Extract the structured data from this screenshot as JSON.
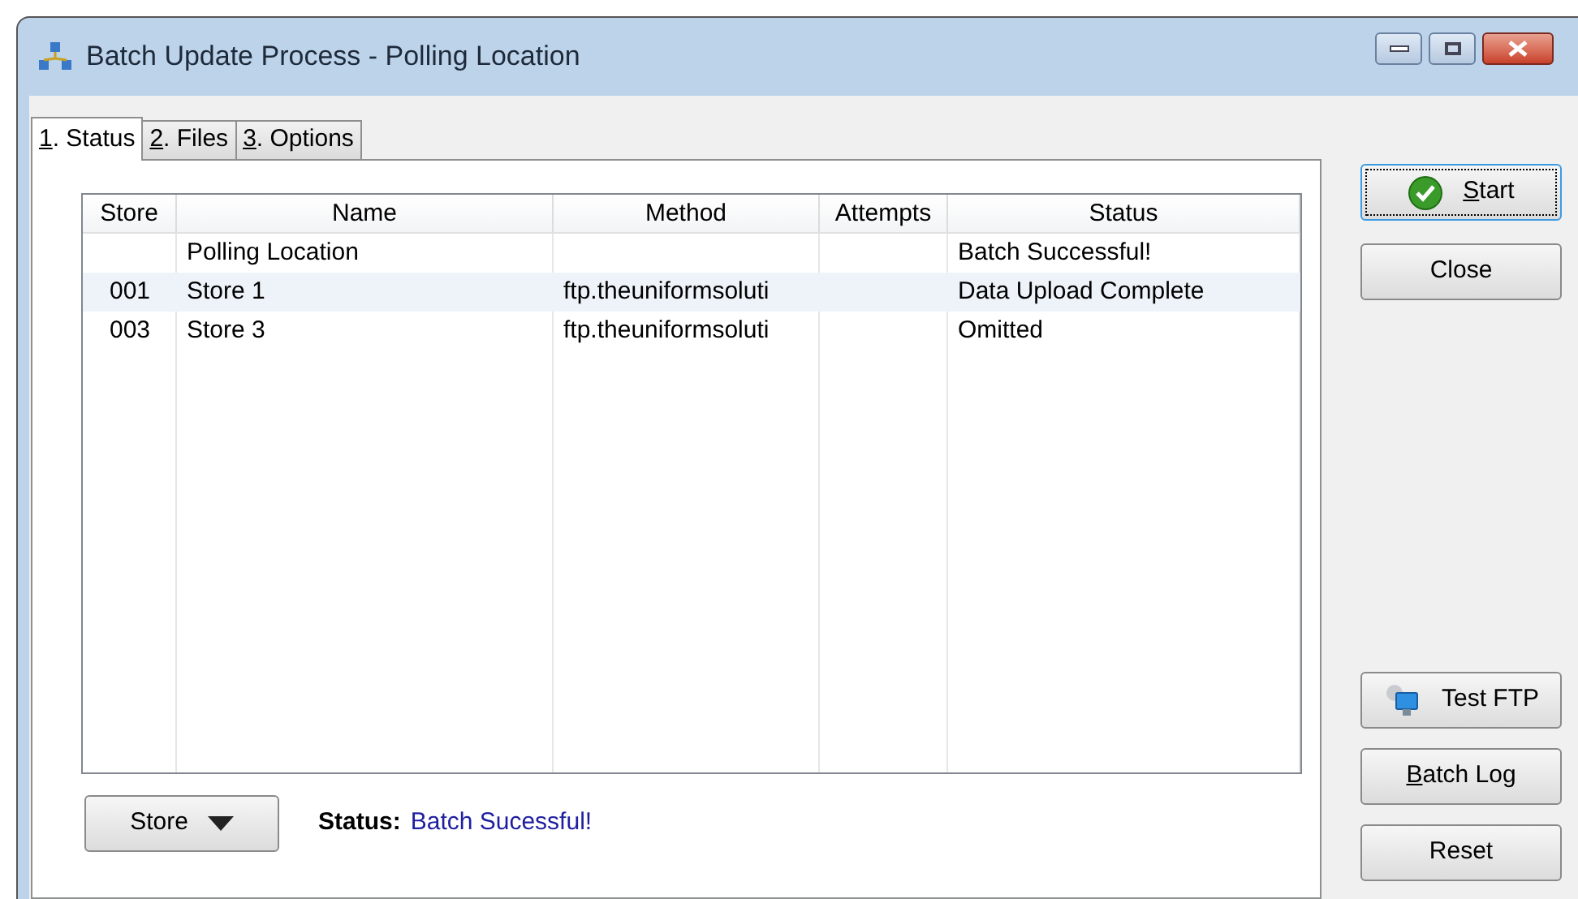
{
  "window": {
    "title": "Batch Update Process - Polling Location"
  },
  "tabs": [
    {
      "mnemonic": "1",
      "label_rest": ". Status",
      "selected": true
    },
    {
      "mnemonic": "2",
      "label_rest": ". Files",
      "selected": false
    },
    {
      "mnemonic": "3",
      "label_rest": ". Options",
      "selected": false
    }
  ],
  "table": {
    "columns": [
      "Store",
      "Name",
      "Method",
      "Attempts",
      "Status"
    ],
    "rows": [
      {
        "cells": [
          "",
          "Polling Location",
          "",
          "",
          "Batch Successful!"
        ],
        "selected": false
      },
      {
        "cells": [
          "001",
          "Store 1",
          "ftp.theuniformsoluti",
          "",
          "Data Upload Complete"
        ],
        "selected": true
      },
      {
        "cells": [
          "003",
          "Store 3",
          "ftp.theuniformsoluti",
          "",
          "Omitted"
        ],
        "selected": false
      }
    ]
  },
  "store_button": {
    "label": "Store"
  },
  "status": {
    "label": "Status:",
    "value": "Batch Sucessful!"
  },
  "buttons": [
    {
      "mnemonic": "S",
      "label_rest": "tart",
      "kind": "start",
      "focused": true
    },
    {
      "label": "Close",
      "kind": "plain",
      "focused": false
    },
    {
      "label": "Test FTP",
      "kind": "ftp",
      "focused": false
    },
    {
      "mnemonic": "B",
      "label_rest": "atch Log",
      "kind": "plain",
      "focused": false
    },
    {
      "label": "Reset",
      "kind": "plain",
      "focused": false
    }
  ]
}
